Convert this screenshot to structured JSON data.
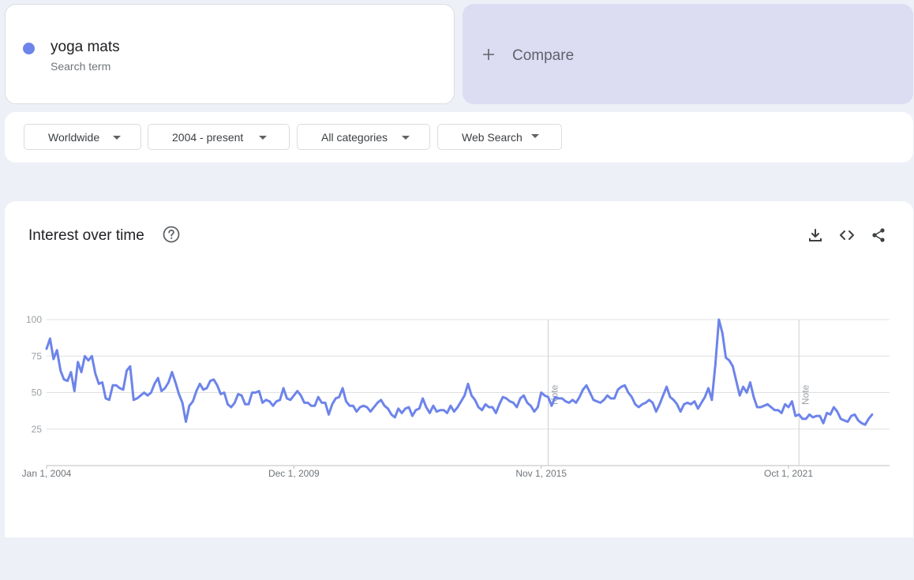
{
  "term": {
    "name": "yoga mats",
    "subtitle": "Search term",
    "color": "#6d84ea"
  },
  "compare": {
    "label": "Compare"
  },
  "filters": {
    "region": "Worldwide",
    "time": "2004 - present",
    "category": "All categories",
    "property": "Web Search"
  },
  "chart": {
    "title": "Interest over time",
    "note_label": "Note"
  },
  "icons": [
    "help-icon",
    "download-icon",
    "embed-icon",
    "share-icon"
  ],
  "chart_data": {
    "type": "line",
    "series_color": "#6d84ea",
    "x_tick_labels": [
      "Jan 1, 2004",
      "Dec 1, 2009",
      "Nov 1, 2015",
      "Oct 1, 2021"
    ],
    "y_ticks": [
      25,
      50,
      75,
      100
    ],
    "ylim": [
      0,
      100
    ],
    "x_range": [
      "2004-01",
      "2024-03"
    ],
    "grid": true,
    "notes": [
      "2016-01",
      "2022-01"
    ],
    "series": [
      {
        "start": "2004-01",
        "step": "month",
        "values": [
          80,
          87,
          73,
          79,
          65,
          59,
          58,
          64,
          51,
          71,
          64,
          75,
          72,
          75,
          63,
          56,
          57,
          46,
          45,
          55,
          55,
          53,
          52,
          65,
          68,
          45,
          46,
          48,
          50,
          48,
          50,
          56,
          60,
          51,
          53,
          57,
          64,
          57,
          49,
          43,
          30,
          41,
          44,
          51,
          56,
          52,
          53,
          58,
          59,
          55,
          49,
          50,
          42,
          40,
          43,
          49,
          48,
          42,
          42,
          50,
          50,
          51,
          43,
          45,
          44,
          41,
          44,
          45,
          53,
          46,
          45,
          48,
          51,
          48,
          43,
          43,
          41,
          41,
          47,
          43,
          43,
          35,
          42,
          46,
          47,
          53,
          44,
          41,
          41,
          37,
          40,
          41,
          40,
          37,
          40,
          43,
          45,
          41,
          39,
          35,
          33,
          39,
          36,
          39,
          40,
          34,
          38,
          39,
          46,
          40,
          36,
          41,
          37,
          38,
          38,
          36,
          41,
          37,
          40,
          44,
          48,
          56,
          48,
          45,
          40,
          38,
          42,
          40,
          40,
          36,
          42,
          47,
          46,
          44,
          43,
          40,
          46,
          48,
          43,
          41,
          37,
          40,
          50,
          48,
          47,
          41,
          47,
          46,
          46,
          44,
          43,
          45,
          43,
          47,
          52,
          55,
          50,
          45,
          44,
          43,
          45,
          48,
          46,
          46,
          52,
          54,
          55,
          50,
          47,
          42,
          40,
          42,
          43,
          45,
          43,
          37,
          42,
          48,
          54,
          47,
          45,
          42,
          37,
          42,
          43,
          42,
          44,
          39,
          43,
          47,
          53,
          45,
          69,
          100,
          91,
          74,
          72,
          68,
          58,
          48,
          54,
          50,
          57,
          47,
          40,
          40,
          41,
          42,
          40,
          38,
          38,
          36,
          42,
          40,
          44,
          34,
          35,
          32,
          32,
          35,
          33,
          34,
          34,
          29,
          36,
          35,
          40,
          37,
          32,
          31,
          30,
          34,
          35,
          31,
          29,
          28,
          32,
          35
        ]
      }
    ]
  }
}
